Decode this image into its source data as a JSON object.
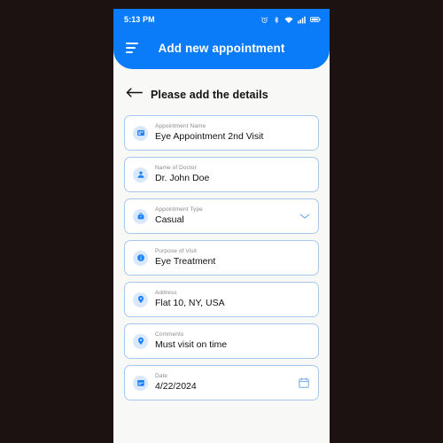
{
  "status_bar": {
    "time": "5:13 PM",
    "icons": [
      "alarm-clock-icon",
      "bluetooth-icon",
      "wifi-icon",
      "cellular-signal-icon",
      "battery-icon"
    ]
  },
  "app_bar": {
    "menu_icon": "hamburger-menu-icon",
    "title": "Add new appointment",
    "background_color": "#0a7cfa"
  },
  "page_header": {
    "back_icon": "back-arrow-icon",
    "title": "Please add the details"
  },
  "theme": {
    "accent": "#0a7cfa",
    "field_border": "#a9c9ea",
    "icon_bubble": "#d9e9fb",
    "screen_background": "#f8f8f7",
    "label_text": "#8b8b8b",
    "value_text": "#101010"
  },
  "form": {
    "fields": [
      {
        "label": "Appointment Name",
        "value": "Eye Appointment 2nd Visit",
        "icon": "appointment-card-icon",
        "trailing": null
      },
      {
        "label": "Name of Doctor",
        "value": "Dr. John Doe",
        "icon": "person-icon",
        "trailing": null
      },
      {
        "label": "Appointment Type",
        "value": "Casual",
        "icon": "bag-icon",
        "trailing": "chevron-down-icon"
      },
      {
        "label": "Purpose of Visit",
        "value": "Eye Treatment",
        "icon": "info-icon",
        "trailing": null
      },
      {
        "label": "Address",
        "value": "Flat 10, NY, USA",
        "icon": "location-pin-icon",
        "trailing": null
      },
      {
        "label": "Comments",
        "value": "Must visit on time",
        "icon": "location-pin-icon",
        "trailing": null
      },
      {
        "label": "Date",
        "value": "4/22/2024",
        "icon": "calendar-icon",
        "trailing": "calendar-picker-icon"
      }
    ]
  }
}
